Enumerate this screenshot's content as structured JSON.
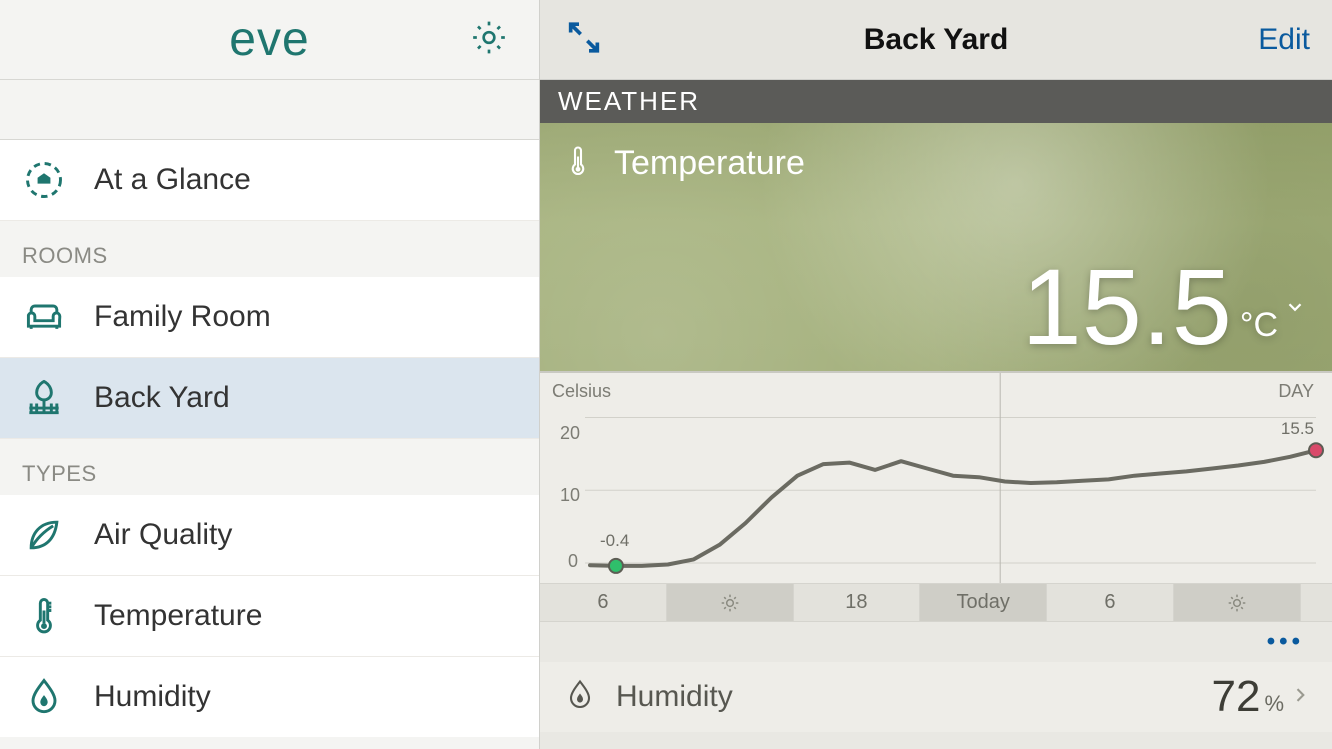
{
  "sidebar": {
    "logo": "eve",
    "at_a_glance": "At a Glance",
    "rooms_label": "ROOMS",
    "types_label": "TYPES",
    "rooms": [
      {
        "label": "Family Room"
      },
      {
        "label": "Back Yard"
      }
    ],
    "types": [
      {
        "label": "Air Quality"
      },
      {
        "label": "Temperature"
      },
      {
        "label": "Humidity"
      }
    ]
  },
  "main": {
    "title": "Back Yard",
    "edit": "Edit",
    "section": "WEATHER",
    "temperature": {
      "label": "Temperature",
      "value": "15.5",
      "unit": "°C"
    },
    "humidity": {
      "label": "Humidity",
      "value": "72",
      "unit": "%"
    }
  },
  "chart_data": {
    "type": "line",
    "title": "",
    "ylabel": "Celsius",
    "xlabel": "",
    "ylim": [
      0,
      22
    ],
    "range_label": "DAY",
    "x": [
      0,
      1,
      2,
      3,
      4,
      5,
      6,
      7,
      8,
      9,
      10,
      11,
      12,
      13,
      14,
      15,
      16,
      17,
      18,
      19,
      20,
      21,
      22,
      23,
      24,
      25,
      26,
      27,
      28
    ],
    "values": [
      -0.3,
      -0.4,
      -0.4,
      -0.2,
      0.5,
      2.5,
      5.5,
      9.0,
      12.0,
      13.6,
      13.8,
      12.8,
      14.0,
      13.0,
      12.0,
      11.8,
      11.2,
      11.0,
      11.1,
      11.3,
      11.5,
      12.0,
      12.3,
      12.6,
      13.0,
      13.4,
      13.9,
      14.6,
      15.5
    ],
    "start_value_label": "-0.4",
    "end_value_label": "15.5",
    "timeline": [
      "6",
      "sun",
      "18",
      "Today",
      "6",
      "sun",
      ""
    ]
  },
  "colors": {
    "accent": "#1f766f",
    "link": "#0a5a9e"
  }
}
